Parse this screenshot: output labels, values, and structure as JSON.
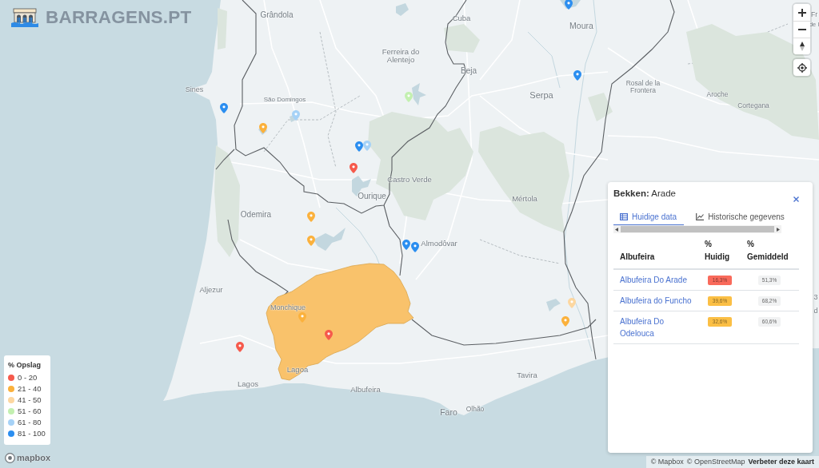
{
  "logo": {
    "title": "BARRAGENS.PT"
  },
  "map": {
    "places": [
      "Grândola",
      "Cuba",
      "Fr",
      "Moura",
      "de l",
      "Ferreira do Alentejo",
      "Beja",
      "Sines",
      "São Domingos",
      "Serpa",
      "Rosal de la Frontera",
      "Aroche",
      "Cortegana",
      "Castro Verde",
      "Ourique",
      "Mértola",
      "Odemira",
      "Almodôvar",
      "Aljezur",
      "3",
      "Monchique",
      "d",
      "Lagoa",
      "Tavira",
      "Lagos",
      "Albufeira",
      "Faro",
      "Olhão"
    ],
    "markers": [
      {
        "color": "#2b8ef0"
      },
      {
        "color": "#2b8ef0"
      },
      {
        "color": "#2b8ef0"
      },
      {
        "color": "#fbb13c"
      },
      {
        "color": "#a6d2f7"
      },
      {
        "color": "#c3f0b0"
      },
      {
        "color": "#2b8ef0"
      },
      {
        "color": "#a6d2f7"
      },
      {
        "color": "#f65a4c"
      },
      {
        "color": "#fbb13c"
      },
      {
        "color": "#fbb13c"
      },
      {
        "color": "#2b8ef0"
      },
      {
        "color": "#2b8ef0"
      },
      {
        "color": "#fdd7a0"
      },
      {
        "color": "#fbb13c"
      },
      {
        "color": "#fbb13c"
      },
      {
        "color": "#f65a4c"
      },
      {
        "color": "#f65a4c"
      }
    ]
  },
  "legend": {
    "title": "% Opslag",
    "items": [
      {
        "label": "0 - 20",
        "color": "#f65a4c"
      },
      {
        "label": "21 - 40",
        "color": "#fbb13c"
      },
      {
        "label": "41 - 50",
        "color": "#fdd7a0"
      },
      {
        "label": "51 - 60",
        "color": "#c3f0b0"
      },
      {
        "label": "61 - 80",
        "color": "#a6d2f7"
      },
      {
        "label": "81 - 100",
        "color": "#2b8ef0"
      }
    ]
  },
  "panel": {
    "title": "**Bekken:** Arade",
    "tabs": [
      {
        "label": "Huidige data",
        "kind": "table",
        "selected": true
      },
      {
        "label": "Historische gegevens",
        "kind": "chart",
        "selected": false
      }
    ],
    "columns": [
      "Albufeira",
      "% Huidig",
      "% Gemiddeld"
    ],
    "rows": [
      {
        "name": "Albufeira Do Arade",
        "current": "16,3%",
        "color": "#f96a5b",
        "average": "51,3%"
      },
      {
        "name": "Albufeira do Funcho",
        "current": "39,6%",
        "color": "#fbbf45",
        "average": "68,2%"
      },
      {
        "name": "Albufeira Do Odelouca",
        "current": "32,6%",
        "color": "#fbbf45",
        "average": "60,6%"
      }
    ]
  },
  "attribution": {
    "logo": "mapbox",
    "links": [
      "© Mapbox",
      "© OpenStreetMap",
      "Verbeter deze kaart"
    ]
  }
}
